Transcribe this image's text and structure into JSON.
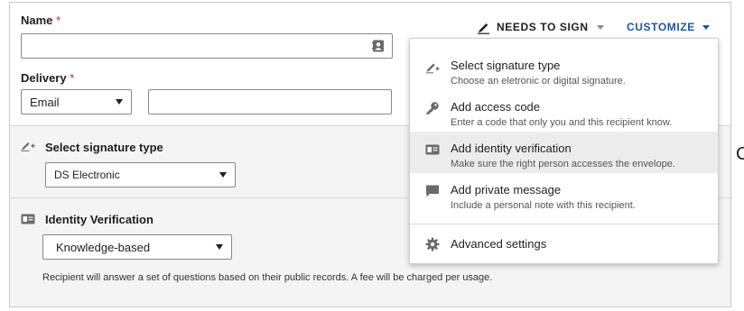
{
  "name_field": {
    "label": "Name",
    "required_mark": "*",
    "value": ""
  },
  "delivery_field": {
    "label": "Delivery",
    "required_mark": "*",
    "method": "Email",
    "value": ""
  },
  "action": {
    "label": "NEEDS TO SIGN"
  },
  "customize": {
    "label": "CUSTOMIZE"
  },
  "signature_section": {
    "title": "Select signature type",
    "selected": "DS Electronic"
  },
  "identity_section": {
    "title": "Identity Verification",
    "selected": "Knowledge-based",
    "note": "Recipient will answer a set of questions based on their public records. A fee will be charged per usage."
  },
  "customize_menu": {
    "items": [
      {
        "title": "Select signature type",
        "desc": "Choose an eletronic or digital signature.",
        "icon": "signature-icon"
      },
      {
        "title": "Add access code",
        "desc": "Enter a code that only you and this recipient know.",
        "icon": "key-icon"
      },
      {
        "title": "Add identity verification",
        "desc": "Make sure the right person accesses the envelope.",
        "icon": "id-card-icon",
        "highlighted": true
      },
      {
        "title": "Add private message",
        "desc": "Include a personal note with this recipient.",
        "icon": "message-icon"
      }
    ],
    "advanced": {
      "title": "Advanced settings",
      "icon": "gear-icon"
    }
  },
  "edge_glyph": "C",
  "colors": {
    "accent": "#1b55a5",
    "required": "#c62828",
    "section_bg": "#f4f4f4",
    "highlight": "#ececec"
  }
}
